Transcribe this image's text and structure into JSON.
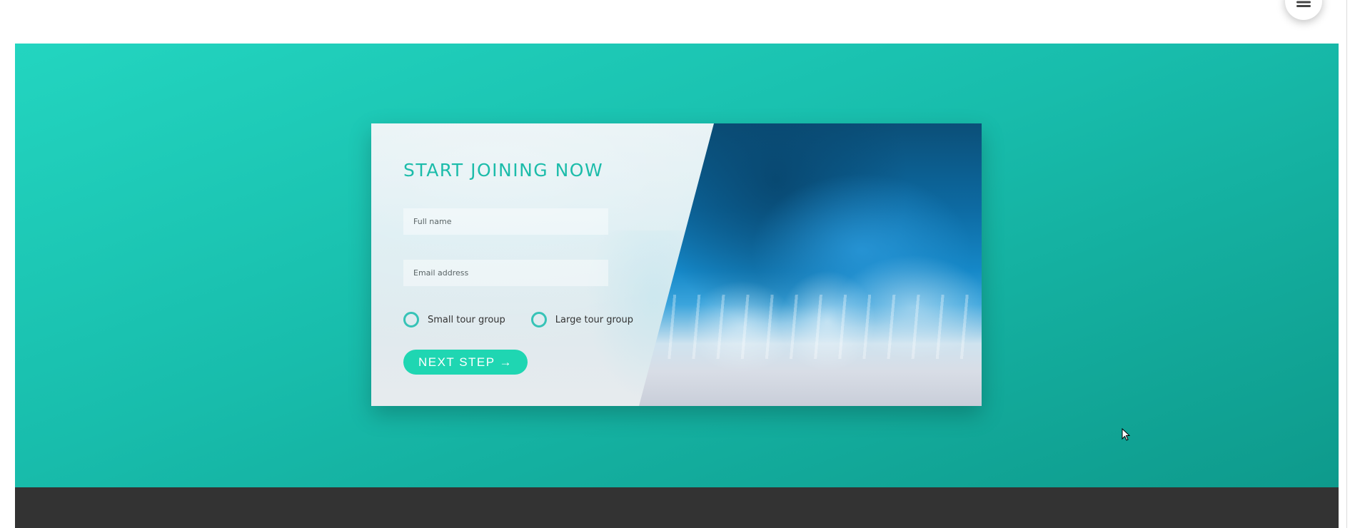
{
  "menu": {
    "icon": "hamburger-icon"
  },
  "hero": {
    "gradient_start": "#23d5c0",
    "gradient_end": "#0e9a8c"
  },
  "signup_card": {
    "title": "START JOINING NOW",
    "title_color": "#1cbcaa",
    "fields": {
      "full_name_placeholder": "Full name",
      "email_placeholder": "Email address"
    },
    "options": {
      "small_label": "Small tour group",
      "large_label": "Large tour group"
    },
    "next_button_label": "NEXT STEP →",
    "accent_color": "#1fd6b2",
    "image": "aerial-ocean-waves-photo"
  },
  "footer": {
    "color": "#333333"
  }
}
